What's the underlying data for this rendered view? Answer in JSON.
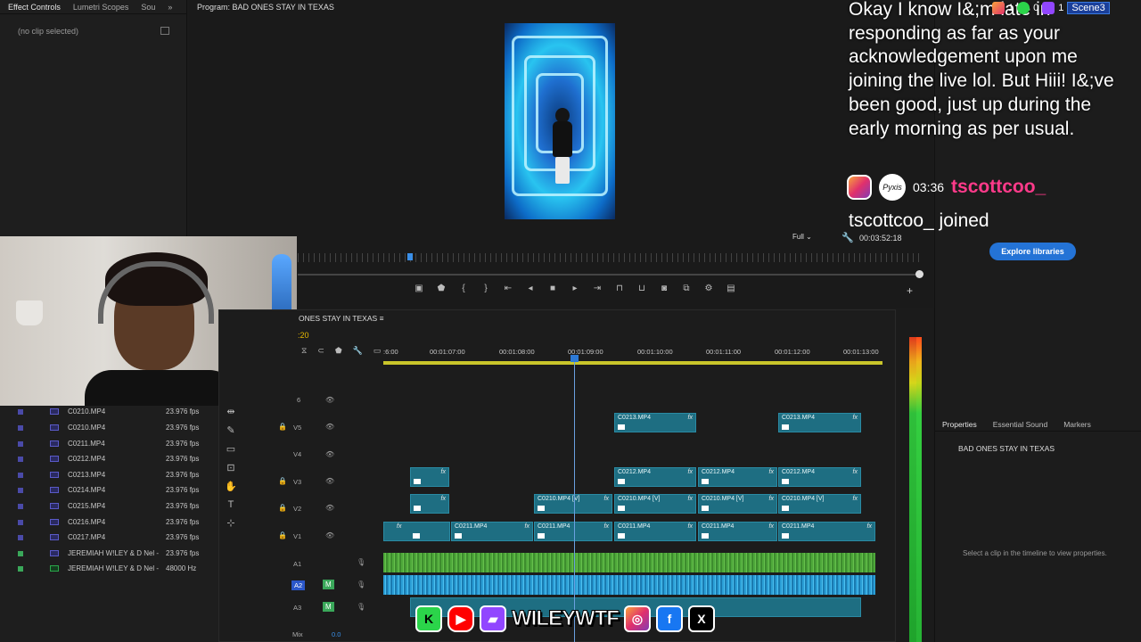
{
  "left_panel": {
    "tabs": [
      "Effect Controls",
      "Lumetri Scopes",
      "Sou"
    ],
    "no_clip": "(no clip selected)"
  },
  "program": {
    "title": "Program: BAD ONES STAY IN TEXAS",
    "scale": "Full",
    "timecode": "00:03:52:18"
  },
  "right_panel": {
    "explore_label": "Explore libraries",
    "tabs": [
      "Properties",
      "Essential Sound",
      "Markers"
    ],
    "sequence_name": "BAD ONES STAY IN TEXAS",
    "select_clip_msg": "Select a clip in the timeline to view properties."
  },
  "project": {
    "rows": [
      {
        "name": "C0210.MP4",
        "fps": "23.976 fps",
        "type": "video"
      },
      {
        "name": "C0210.MP4",
        "fps": "23.976 fps",
        "type": "video"
      },
      {
        "name": "C0211.MP4",
        "fps": "23.976 fps",
        "type": "video"
      },
      {
        "name": "C0212.MP4",
        "fps": "23.976 fps",
        "type": "video"
      },
      {
        "name": "C0213.MP4",
        "fps": "23.976 fps",
        "type": "video"
      },
      {
        "name": "C0214.MP4",
        "fps": "23.976 fps",
        "type": "video"
      },
      {
        "name": "C0215.MP4",
        "fps": "23.976 fps",
        "type": "video"
      },
      {
        "name": "C0216.MP4",
        "fps": "23.976 fps",
        "type": "video"
      },
      {
        "name": "C0217.MP4",
        "fps": "23.976 fps",
        "type": "video"
      },
      {
        "name": "JEREMIAH W!LEY & D Nel -",
        "fps": "23.976 fps",
        "type": "video"
      },
      {
        "name": "JEREMIAH W!LEY & D Nel -",
        "fps": "48000 Hz",
        "type": "audio"
      }
    ]
  },
  "timeline": {
    "sequence_tab": "ONES STAY IN TEXAS",
    "current_time": ":20",
    "ruler": [
      ":6:00",
      "00:01:07:00",
      "00:01:08:00",
      "00:01:09:00",
      "00:01:10:00",
      "00:01:11:00",
      "00:01:12:00",
      "00:01:13:00"
    ],
    "tracks": [
      "6",
      "V5",
      "V4",
      "V3",
      "V2",
      "V1",
      "A1",
      "A2",
      "A3",
      "Mix"
    ],
    "mix_value": "0.0",
    "clips": {
      "v5a": "C0213.MP4",
      "v5b": "C0213.MP4",
      "v3a": "C0212.MP4",
      "v3b": "C0212.MP4",
      "v3c": "C0212.MP4",
      "v2a": "C0210.MP4 [V]",
      "v2b": "C0210.MP4 [V]",
      "v2c": "C0210.MP4 [V]",
      "v2d": "C0210.MP4 [V]",
      "v1a": "C0211.MP4",
      "v1b": "C0211.MP4",
      "v1c": "C0211.MP4",
      "v1d": "C0211.MP4",
      "v1e": "C0211.MP4",
      "fx": "fx"
    }
  },
  "chat": {
    "message": "Okay I know I&;m late in responding as far as your acknowledgement upon me joining the live lol. But Hiii! I&;ve been good, just up during the early morning as per usual.",
    "time": "03:36",
    "user": "tscottcoo_",
    "joined": "tscottcoo_ joined",
    "pfp_label": "Pyxis",
    "stats": [
      "1",
      "0",
      "1"
    ],
    "scene": "Scene3"
  },
  "social": {
    "handle": "WILEYWTF"
  }
}
